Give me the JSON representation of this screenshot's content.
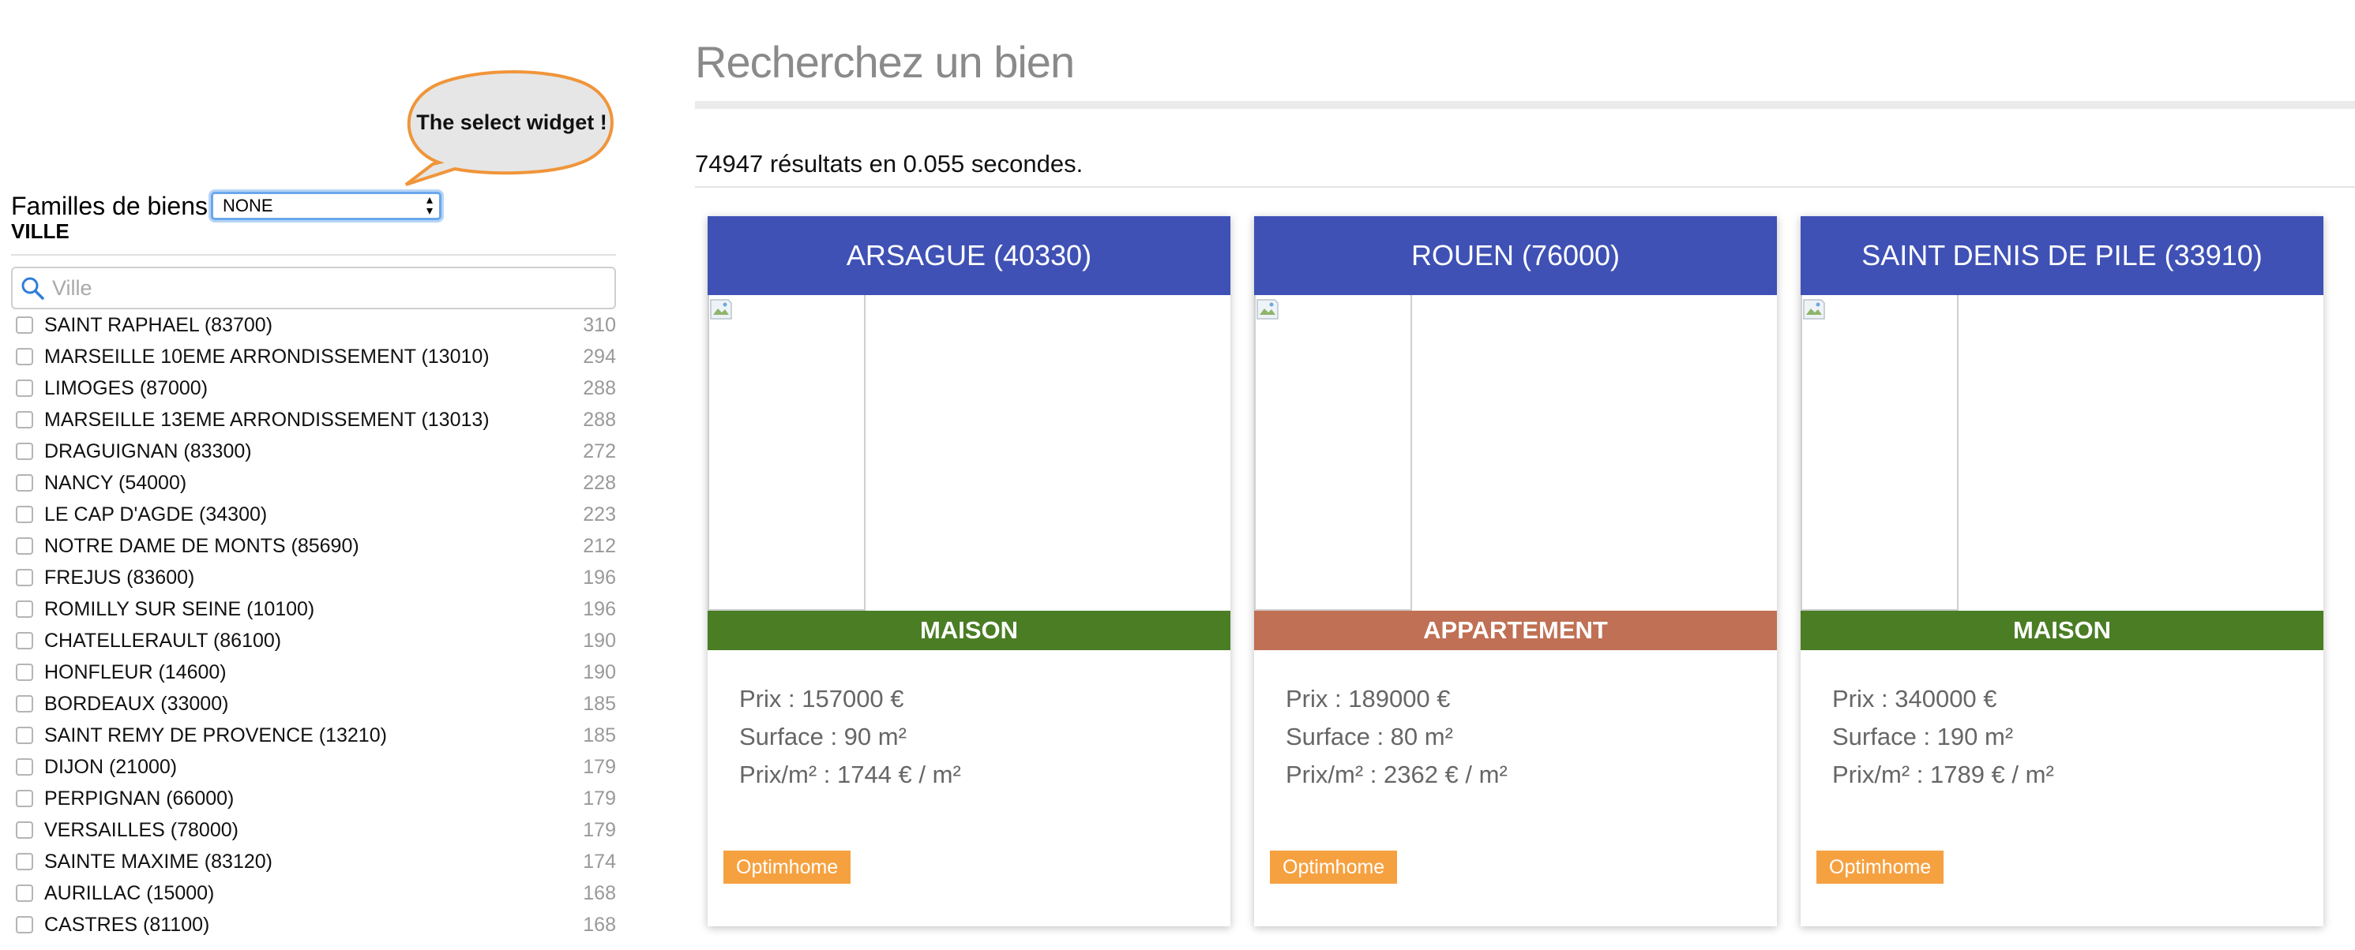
{
  "callout": {
    "text": "The select widget !"
  },
  "filters": {
    "familles": {
      "label": "Familles de biens",
      "selected": "NONE"
    },
    "ville": {
      "heading": "VILLE",
      "search_placeholder": "Ville",
      "items": [
        {
          "name": "SAINT RAPHAEL (83700)",
          "count": "310"
        },
        {
          "name": "MARSEILLE 10EME ARRONDISSEMENT (13010)",
          "count": "294"
        },
        {
          "name": "LIMOGES (87000)",
          "count": "288"
        },
        {
          "name": "MARSEILLE 13EME ARRONDISSEMENT (13013)",
          "count": "288"
        },
        {
          "name": "DRAGUIGNAN (83300)",
          "count": "272"
        },
        {
          "name": "NANCY (54000)",
          "count": "228"
        },
        {
          "name": "LE CAP D'AGDE (34300)",
          "count": "223"
        },
        {
          "name": "NOTRE DAME DE MONTS (85690)",
          "count": "212"
        },
        {
          "name": "FREJUS (83600)",
          "count": "196"
        },
        {
          "name": "ROMILLY SUR SEINE (10100)",
          "count": "196"
        },
        {
          "name": "CHATELLERAULT (86100)",
          "count": "190"
        },
        {
          "name": "HONFLEUR (14600)",
          "count": "190"
        },
        {
          "name": "BORDEAUX (33000)",
          "count": "185"
        },
        {
          "name": "SAINT REMY DE PROVENCE (13210)",
          "count": "185"
        },
        {
          "name": "DIJON (21000)",
          "count": "179"
        },
        {
          "name": "PERPIGNAN (66000)",
          "count": "179"
        },
        {
          "name": "VERSAILLES (78000)",
          "count": "179"
        },
        {
          "name": "SAINTE MAXIME (83120)",
          "count": "174"
        },
        {
          "name": "AURILLAC (15000)",
          "count": "168"
        },
        {
          "name": "CASTRES (81100)",
          "count": "168"
        }
      ]
    }
  },
  "main": {
    "title": "Recherchez un bien",
    "results": "74947 résultats en 0.055 secondes.",
    "cards": [
      {
        "city": "ARSAGUE (40330)",
        "type": "MAISON",
        "type_color": "#4a7d24",
        "prix": "Prix : 157000 €",
        "surface": "Surface : 90 m²",
        "prix_m2": "Prix/m² : 1744 € / m²",
        "source": "Optimhome"
      },
      {
        "city": "ROUEN (76000)",
        "type": "APPARTEMENT",
        "type_color": "#c07054",
        "prix": "Prix : 189000 €",
        "surface": "Surface : 80 m²",
        "prix_m2": "Prix/m² : 2362 € / m²",
        "source": "Optimhome"
      },
      {
        "city": "SAINT DENIS DE PILE (33910)",
        "type": "MAISON",
        "type_color": "#4a7d24",
        "prix": "Prix : 340000 €",
        "surface": "Surface : 190 m²",
        "prix_m2": "Prix/m² : 1789 € / m²",
        "source": "Optimhome"
      }
    ]
  },
  "colors": {
    "header": "#3f51b5",
    "source_badge": "#f6a140",
    "callout_border": "#f0953a"
  }
}
